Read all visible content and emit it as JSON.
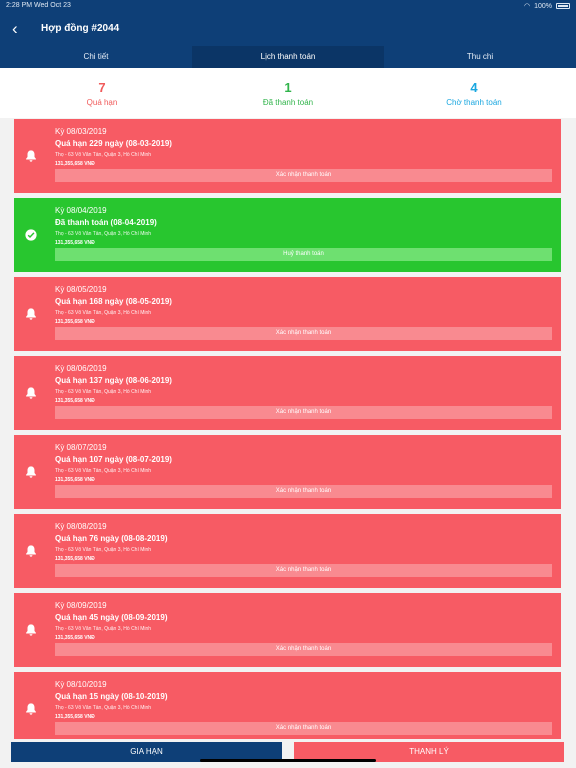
{
  "status": {
    "time": "2:28 PM",
    "date": "Wed Oct 23",
    "battery": "100%"
  },
  "header": {
    "title": "Hợp đồng #2044"
  },
  "tabs": [
    {
      "label": "Chi tiết"
    },
    {
      "label": "Lịch thanh toán"
    },
    {
      "label": "Thu chi"
    }
  ],
  "summary": {
    "overdue": {
      "count": "7",
      "label": "Quá hạn"
    },
    "paid": {
      "count": "1",
      "label": "Đã thanh toán"
    },
    "waiting": {
      "count": "4",
      "label": "Chờ thanh toán"
    }
  },
  "colors": {
    "overdue": "#f75b64",
    "paid": "#28c62f",
    "navy": "#0e3f77"
  },
  "cards": [
    {
      "period": "Kỳ 08/03/2019",
      "status": "Quá hạn 229 ngày (08-03-2019)",
      "address": "Thọ - 63 Võ Văn Tần, Quận 3, Hồ Chí Minh",
      "amount": "131,355,658 VNĐ",
      "button": "Xác nhận thanh toán"
    },
    {
      "period": "Kỳ 08/04/2019",
      "status": "Đã thanh toán (08-04-2019)",
      "address": "Thọ - 63 Võ Văn Tần, Quận 3, Hồ Chí Minh",
      "amount": "131,355,658 VNĐ",
      "button": "Huỷ thanh toán"
    },
    {
      "period": "Kỳ 08/05/2019",
      "status": "Quá hạn 168 ngày (08-05-2019)",
      "address": "Thọ - 63 Võ Văn Tần, Quận 3, Hồ Chí Minh",
      "amount": "131,355,658 VNĐ",
      "button": "Xác nhận thanh toán"
    },
    {
      "period": "Kỳ 08/06/2019",
      "status": "Quá hạn 137 ngày (08-06-2019)",
      "address": "Thọ - 63 Võ Văn Tần, Quận 3, Hồ Chí Minh",
      "amount": "131,355,658 VNĐ",
      "button": "Xác nhận thanh toán"
    },
    {
      "period": "Kỳ 08/07/2019",
      "status": "Quá hạn 107 ngày (08-07-2019)",
      "address": "Thọ - 63 Võ Văn Tần, Quận 3, Hồ Chí Minh",
      "amount": "131,355,658 VNĐ",
      "button": "Xác nhận thanh toán"
    },
    {
      "period": "Kỳ 08/08/2019",
      "status": "Quá hạn 76 ngày (08-08-2019)",
      "address": "Thọ - 63 Võ Văn Tần, Quận 3, Hồ Chí Minh",
      "amount": "131,355,658 VNĐ",
      "button": "Xác nhận thanh toán"
    },
    {
      "period": "Kỳ 08/09/2019",
      "status": "Quá hạn 45 ngày (08-09-2019)",
      "address": "Thọ - 63 Võ Văn Tần, Quận 3, Hồ Chí Minh",
      "amount": "131,355,658 VNĐ",
      "button": "Xác nhận thanh toán"
    },
    {
      "period": "Kỳ 08/10/2019",
      "status": "Quá hạn 15 ngày (08-10-2019)",
      "address": "Thọ - 63 Võ Văn Tần, Quận 3, Hồ Chí Minh",
      "amount": "131,355,658 VNĐ",
      "button": "Xác nhận thanh toán"
    }
  ],
  "footer": {
    "extend_label": "GIA HẠN",
    "liquidate_label": "THANH LÝ"
  }
}
